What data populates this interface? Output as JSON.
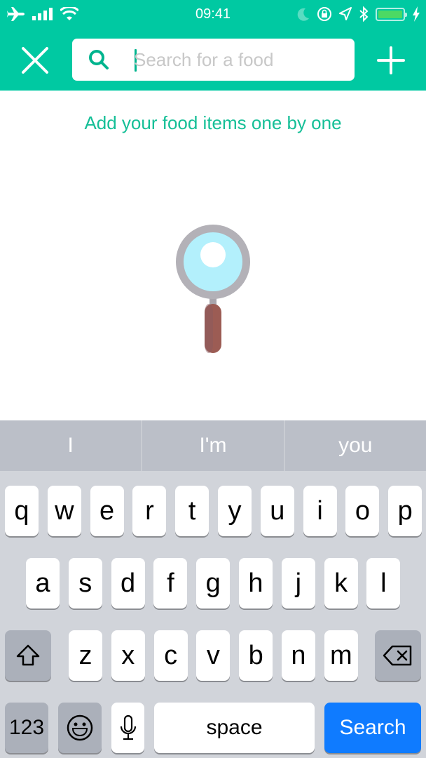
{
  "status_bar": {
    "time": "09:41",
    "left_icons": [
      "airplane-icon",
      "signal-icon",
      "wifi-icon"
    ],
    "right_icons": [
      "moon-icon",
      "orientation-lock-icon",
      "location-icon",
      "bluetooth-icon",
      "battery-icon",
      "charging-icon"
    ],
    "battery_level": 1.0
  },
  "nav": {
    "close_icon": "close-icon",
    "add_icon": "plus-icon",
    "search": {
      "placeholder": "Search for a food",
      "value": ""
    }
  },
  "main": {
    "hint": "Add your food items one by one",
    "illustration": "magnifying-glass-illustration"
  },
  "keyboard": {
    "suggestions": [
      "I",
      "I'm",
      "you"
    ],
    "row1": [
      "q",
      "w",
      "e",
      "r",
      "t",
      "y",
      "u",
      "i",
      "o",
      "p"
    ],
    "row2": [
      "a",
      "s",
      "d",
      "f",
      "g",
      "h",
      "j",
      "k",
      "l"
    ],
    "row3": [
      "z",
      "x",
      "c",
      "v",
      "b",
      "n",
      "m"
    ],
    "numbers_label": "123",
    "space_label": "space",
    "action_label": "Search"
  },
  "colors": {
    "brand": "#00c9a2",
    "hint_text": "#15bf97",
    "action_key": "#0f7bff"
  }
}
